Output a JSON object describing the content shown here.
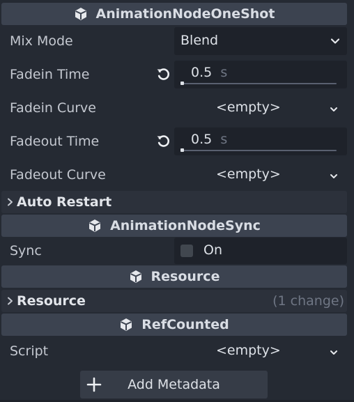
{
  "sections": {
    "oneshot": {
      "title": "AnimationNodeOneShot",
      "icon": "cube-icon"
    },
    "sync": {
      "title": "AnimationNodeSync",
      "icon": "cube-icon"
    },
    "resource": {
      "title": "Resource",
      "icon": "cube-icon"
    },
    "refcounted": {
      "title": "RefCounted",
      "icon": "cube-icon"
    }
  },
  "properties": {
    "mix_mode": {
      "label": "Mix Mode",
      "value": "Blend"
    },
    "fadein_time": {
      "label": "Fadein Time",
      "value": "0.5",
      "unit": "s",
      "slider_fraction": 0.0
    },
    "fadein_curve": {
      "label": "Fadein Curve",
      "value": "<empty>"
    },
    "fadeout_time": {
      "label": "Fadeout Time",
      "value": "0.5",
      "unit": "s",
      "slider_fraction": 0.0
    },
    "fadeout_curve": {
      "label": "Fadeout Curve",
      "value": "<empty>"
    },
    "sync": {
      "label": "Sync",
      "value": "On",
      "checked": false
    },
    "script": {
      "label": "Script",
      "value": "<empty>"
    }
  },
  "groups": {
    "auto_restart": {
      "label": "Auto Restart",
      "collapsed": true
    },
    "resource": {
      "label": "Resource",
      "note": "(1 change)",
      "collapsed": true
    }
  },
  "add_metadata": {
    "label": "Add Metadata"
  },
  "colors": {
    "background": "#252a33",
    "section_header": "#3c4350",
    "field": "#1e222a",
    "text": "#c4c8d0",
    "muted": "#6f7684"
  }
}
